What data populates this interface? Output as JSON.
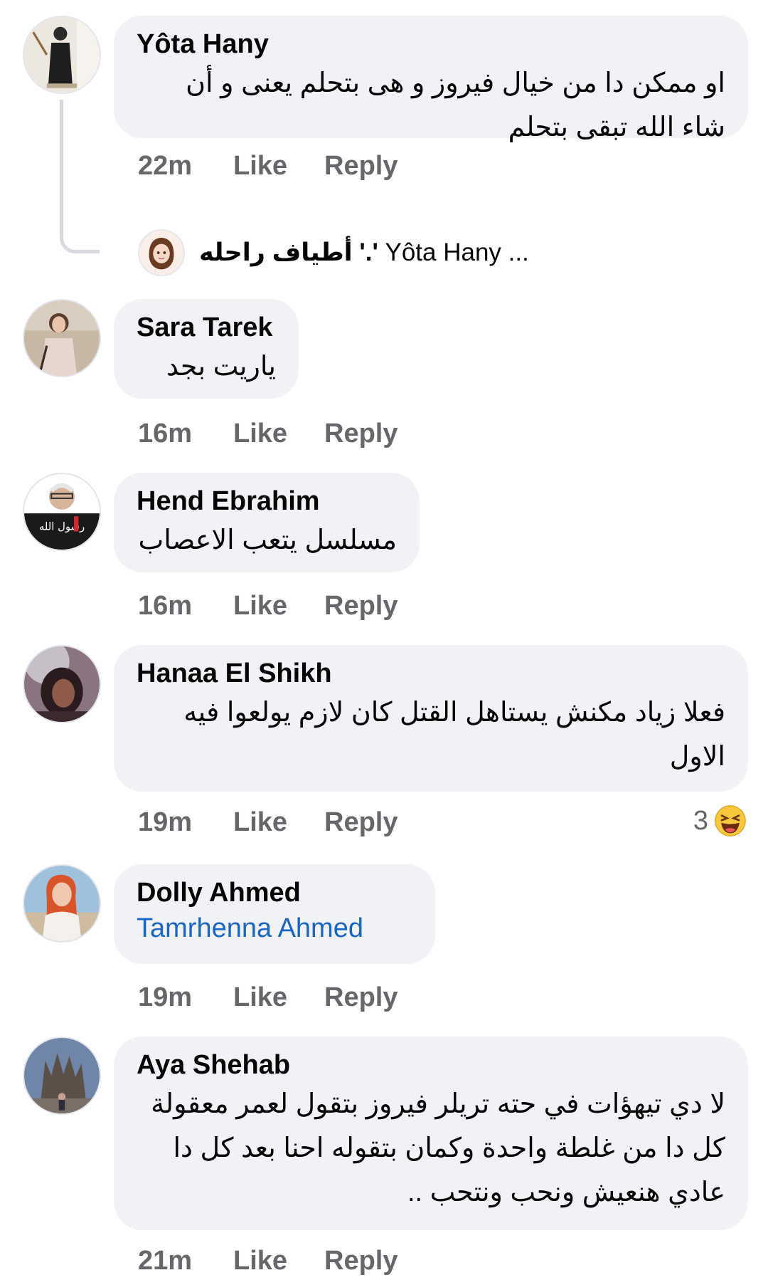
{
  "comments": [
    {
      "author": "Yôta Hany",
      "text": "او ممكن دا من خيال فيروز و هى بتحلم يعنى و أن\nشاء الله تبقى بتحلم",
      "time": "22m",
      "like": "Like",
      "reply": "Reply"
    },
    {
      "author": "Sara Tarek",
      "text": "ياريت بجد",
      "time": "16m",
      "like": "Like",
      "reply": "Reply"
    },
    {
      "author": "Hend Ebrahim",
      "text": "مسلسل يتعب الاعصاب",
      "time": "16m",
      "like": "Like",
      "reply": "Reply"
    },
    {
      "author": "Hanaa El Shikh",
      "text": "فعلا زياد مكنش يستاهل القتل كان لازم يولعوا فيه\nالاول",
      "time": "19m",
      "like": "Like",
      "reply": "Reply",
      "reaction_count": "3",
      "reaction_icon": "laughing-emoji-icon"
    },
    {
      "author": "Dolly Ahmed",
      "text": "Tamrhenna Ahmed",
      "time": "19m",
      "like": "Like",
      "reply": "Reply"
    },
    {
      "author": "Aya Shehab",
      "text": "لا دي تيهؤات في حته تريلر فيروز بتقول لعمر معقولة\nكل دا من غلطة واحدة وكمان بتقوله احنا بعد كل دا\nعادي هنعيش ونحب ونتحب ..",
      "time": "21m",
      "like": "Like",
      "reply": "Reply"
    }
  ],
  "reply_preview": {
    "name": "أطياف راحله '.'",
    "text": "Yôta Hany ..."
  },
  "colors": {
    "bubble": "#f0f2f5",
    "meta": "#65676b",
    "link": "#1a66c8",
    "text": "#050505"
  }
}
